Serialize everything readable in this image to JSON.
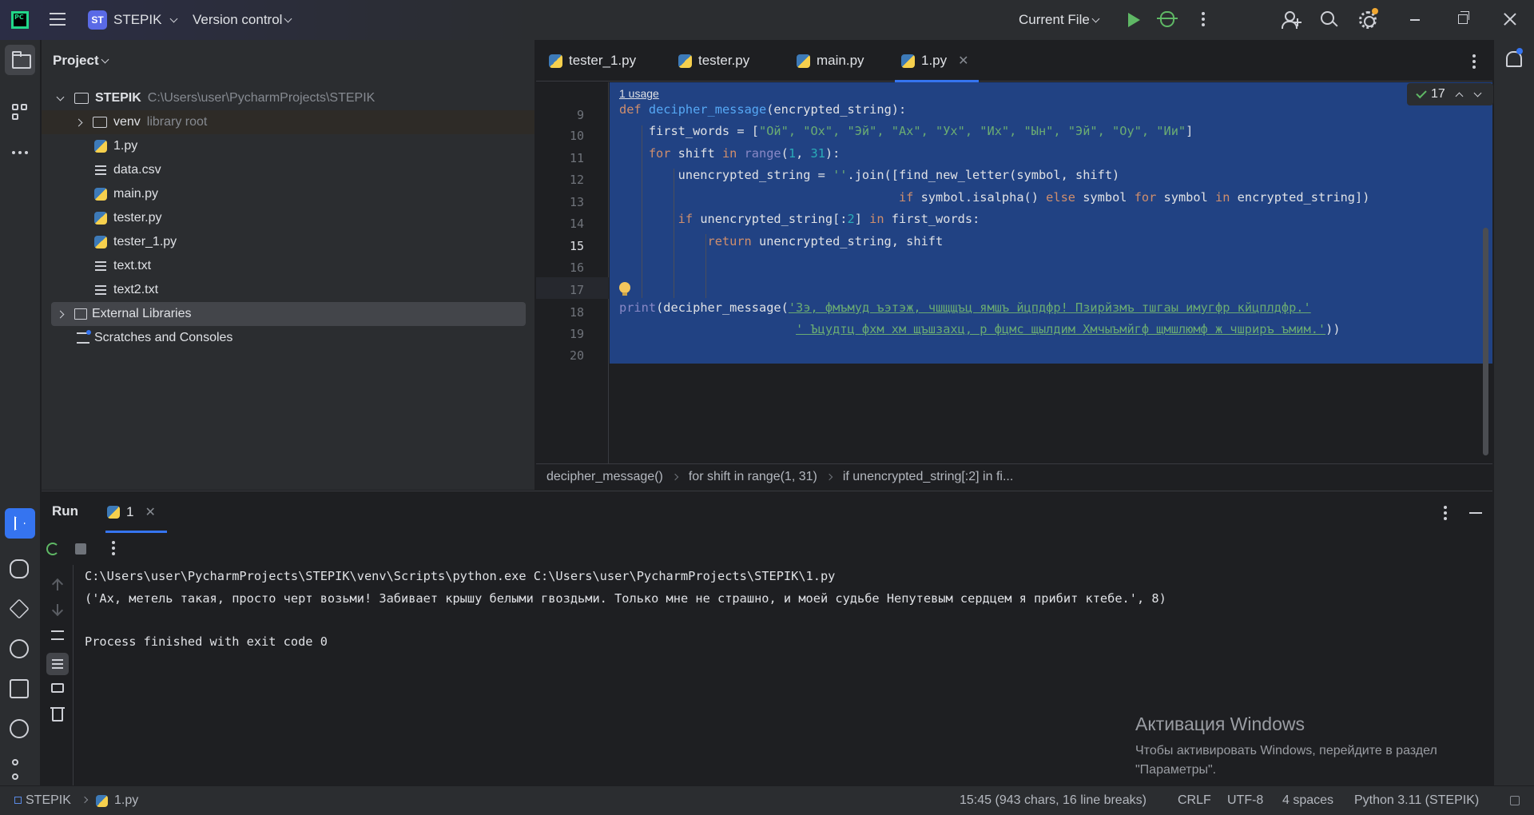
{
  "titlebar": {
    "project_badge": "ST",
    "project_name": "STEPIK",
    "version_control": "Version control",
    "run_config": "Current File"
  },
  "project_panel": {
    "title": "Project",
    "tree": [
      {
        "name": "STEPIK",
        "hint": "C:\\Users\\user\\PycharmProjects\\STEPIK",
        "type": "folder-open"
      },
      {
        "name": "venv",
        "hint": "library root",
        "type": "folder-closed"
      },
      {
        "name": "1.py",
        "type": "python"
      },
      {
        "name": "data.csv",
        "type": "text"
      },
      {
        "name": "main.py",
        "type": "python"
      },
      {
        "name": "tester.py",
        "type": "python"
      },
      {
        "name": "tester_1.py",
        "type": "python"
      },
      {
        "name": "text.txt",
        "type": "text"
      },
      {
        "name": "text2.txt",
        "type": "text"
      },
      {
        "name": "External Libraries",
        "type": "library"
      },
      {
        "name": "Scratches and Consoles",
        "type": "scratch"
      }
    ]
  },
  "editor": {
    "tabs": [
      {
        "label": "tester_1.py"
      },
      {
        "label": "tester.py"
      },
      {
        "label": "main.py"
      },
      {
        "label": "1.py",
        "active": true
      }
    ],
    "usage_hint": "1 usage",
    "inspection_count": "17",
    "line_numbers": [
      "9",
      "10",
      "11",
      "12",
      "13",
      "14",
      "15",
      "16",
      "17",
      "18",
      "19",
      "20"
    ],
    "current_line": "15",
    "code": {
      "l9_kw": "def",
      "l9_fn": "decipher_message",
      "l9_rest": "(encrypted_string):",
      "l10_a": "    first_words = [",
      "l10_s": "\"Ой\", \"Ох\", \"Эй\", \"Ах\", \"Ух\", \"Их\", \"Ын\", \"Эй\", \"Оу\", \"Ии\"",
      "l10_b": "]",
      "l11_kw1": "    for",
      "l11_a": " shift ",
      "l11_kw2": "in",
      "l11_bi": " range",
      "l11_b": "(",
      "l11_n1": "1",
      "l11_c": ", ",
      "l11_n2": "31",
      "l11_d": "):",
      "l12_a": "        unencrypted_string = ",
      "l12_s": "''",
      "l12_b": ".join([find_new_letter(symbol, shift)",
      "l13_kw1": "                                      if",
      "l13_a": " symbol.isalpha() ",
      "l13_kw2": "else",
      "l13_b": " symbol ",
      "l13_kw3": "for",
      "l13_c": " symbol ",
      "l13_kw4": "in",
      "l13_d": " encrypted_string])",
      "l14_kw1": "        if",
      "l14_a": " unencrypted_string[:",
      "l14_n": "2",
      "l14_b": "] ",
      "l14_kw2": "in",
      "l14_c": " first_words:",
      "l15_kw": "            return",
      "l15_a": " unencrypted_string, shift",
      "l18_bi": "print",
      "l18_a": "(decipher_message(",
      "l18_s": "'Зэ, фмъмуд ъэтэж, чшщщъц ямшъ йцпдфр! Пзирйзмъ тшгаы имугфр кйцплдфр.'",
      "l19_pad": "                        ",
      "l19_s": "' Ъцудтц фхм хм щъшзахц, р фцмс щылдим Хмчыъмйгф щмшлюмф ж чшриръ ъмим.'",
      "l19_b": "))"
    },
    "breadcrumbs": [
      "decipher_message()",
      "for shift in range(1, 31)",
      "if unencrypted_string[:2] in fi..."
    ]
  },
  "run_panel": {
    "title": "Run",
    "tab_label": "1",
    "console": [
      "C:\\Users\\user\\PycharmProjects\\STEPIK\\venv\\Scripts\\python.exe C:\\Users\\user\\PycharmProjects\\STEPIK\\1.py",
      "('Ах, метель такая, просто черт возьми! Забивает крышу белыми гвоздьми. Только мне не страшно, и моей судьбе Непутевым сердцем я прибит ктебе.', 8)",
      "",
      "Process finished with exit code 0"
    ],
    "watermark_title": "Активация Windows",
    "watermark_line1": "Чтобы активировать Windows, перейдите в раздел",
    "watermark_line2": "\"Параметры\"."
  },
  "statusbar": {
    "project": "STEPIK",
    "file": "1.py",
    "position": "15:45 (943 chars, 16 line breaks)",
    "line_sep": "CRLF",
    "encoding": "UTF-8",
    "indent": "4 spaces",
    "interpreter": "Python 3.11 (STEPIK)"
  },
  "colors": {
    "accent": "#3574f0",
    "selection": "#214283",
    "run_green": "#5fb865"
  }
}
